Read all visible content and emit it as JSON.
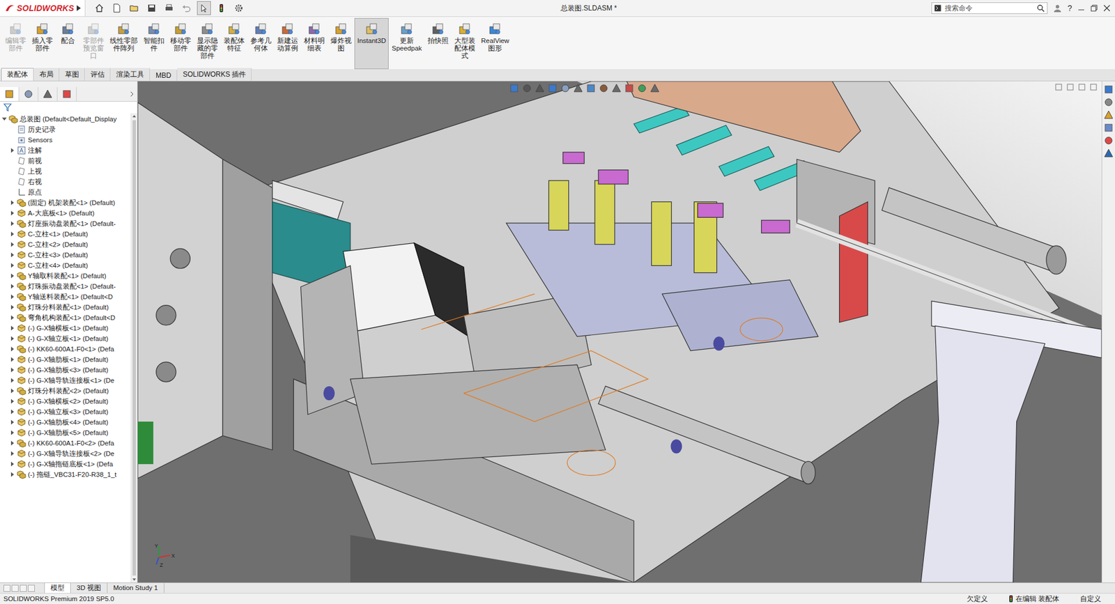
{
  "window": {
    "title": "总装图.SLDASM *"
  },
  "app": {
    "logo": "SOLIDWORKS"
  },
  "search": {
    "placeholder": "搜索命令"
  },
  "help": "?",
  "ribbon": [
    {
      "lines": [
        "编辑零",
        "部件"
      ],
      "disabled": true,
      "selected": false
    },
    {
      "lines": [
        "插入零",
        "部件"
      ],
      "disabled": false,
      "selected": false
    },
    {
      "lines": [
        "配合"
      ],
      "disabled": false,
      "selected": false
    },
    {
      "lines": [
        "零部件",
        "预览窗",
        "口"
      ],
      "disabled": true,
      "selected": false
    },
    {
      "lines": [
        "线性零部",
        "件阵列"
      ],
      "disabled": false,
      "selected": false
    },
    {
      "lines": [
        "智能扣",
        "件"
      ],
      "disabled": false,
      "selected": false
    },
    {
      "lines": [
        "移动零",
        "部件"
      ],
      "disabled": false,
      "selected": false
    },
    {
      "lines": [
        "显示隐",
        "藏的零",
        "部件"
      ],
      "disabled": false,
      "selected": false
    },
    {
      "lines": [
        "装配体",
        "特征"
      ],
      "disabled": false,
      "selected": false
    },
    {
      "lines": [
        "参考几",
        "何体"
      ],
      "disabled": false,
      "selected": false
    },
    {
      "lines": [
        "新建运",
        "动算例"
      ],
      "disabled": false,
      "selected": false
    },
    {
      "lines": [
        "材料明",
        "细表"
      ],
      "disabled": false,
      "selected": false
    },
    {
      "lines": [
        "爆炸视",
        "图"
      ],
      "disabled": false,
      "selected": false
    },
    {
      "lines": [
        "Instant3D"
      ],
      "disabled": false,
      "selected": true
    },
    {
      "lines": [
        "更新",
        "Speedpak"
      ],
      "disabled": false,
      "selected": false
    },
    {
      "lines": [
        "拍快照"
      ],
      "disabled": false,
      "selected": false
    },
    {
      "lines": [
        "大型装",
        "配体模",
        "式"
      ],
      "disabled": false,
      "selected": false
    },
    {
      "lines": [
        "RealView",
        "图形"
      ],
      "disabled": false,
      "selected": false
    }
  ],
  "command_tabs": [
    {
      "label": "装配体",
      "selected": true
    },
    {
      "label": "布局",
      "selected": false
    },
    {
      "label": "草图",
      "selected": false
    },
    {
      "label": "评估",
      "selected": false
    },
    {
      "label": "渲染工具",
      "selected": false
    },
    {
      "label": "MBD",
      "selected": false
    },
    {
      "label": "SOLIDWORKS 插件",
      "selected": false
    }
  ],
  "tree": {
    "root": {
      "label": "总装图  (Default<Default_Display",
      "expanded": true
    },
    "items": [
      {
        "label": "历史记录",
        "kind": "history",
        "expandable": false,
        "expanded": false
      },
      {
        "label": "Sensors",
        "kind": "sensor",
        "expandable": false,
        "expanded": false
      },
      {
        "label": "注解",
        "kind": "annotation",
        "expandable": true,
        "expanded": false
      },
      {
        "label": "前视",
        "kind": "plane",
        "expandable": false,
        "expanded": false
      },
      {
        "label": "上视",
        "kind": "plane",
        "expandable": false,
        "expanded": false
      },
      {
        "label": "右视",
        "kind": "plane",
        "expandable": false,
        "expanded": false
      },
      {
        "label": "原点",
        "kind": "origin",
        "expandable": false,
        "expanded": false
      },
      {
        "label": "(固定) 机架装配<1> (Default)",
        "kind": "assembly",
        "expandable": true,
        "expanded": false
      },
      {
        "label": "A-大底板<1> (Default)",
        "kind": "part",
        "expandable": true,
        "expanded": false
      },
      {
        "label": "灯座振动盘装配<1> (Default-",
        "kind": "assembly",
        "expandable": true,
        "expanded": false
      },
      {
        "label": "C-立柱<1> (Default)",
        "kind": "part",
        "expandable": true,
        "expanded": false
      },
      {
        "label": "C-立柱<2> (Default)",
        "kind": "part",
        "expandable": true,
        "expanded": false
      },
      {
        "label": "C-立柱<3> (Default)",
        "kind": "part",
        "expandable": true,
        "expanded": false
      },
      {
        "label": "C-立柱<4> (Default)",
        "kind": "part",
        "expandable": true,
        "expanded": false
      },
      {
        "label": "Y轴取料装配<1> (Default)",
        "kind": "assembly",
        "expandable": true,
        "expanded": false
      },
      {
        "label": "灯珠振动盘装配<1> (Default-",
        "kind": "assembly",
        "expandable": true,
        "expanded": false
      },
      {
        "label": "Y轴送料装配<1> (Default<D",
        "kind": "assembly",
        "expandable": true,
        "expanded": false
      },
      {
        "label": "灯珠分料装配<1> (Default)",
        "kind": "assembly",
        "expandable": true,
        "expanded": false
      },
      {
        "label": "弯角机构装配<1> (Default<D",
        "kind": "assembly",
        "expandable": true,
        "expanded": false
      },
      {
        "label": "(-) G-X轴横板<1> (Default)",
        "kind": "part",
        "expandable": true,
        "expanded": false
      },
      {
        "label": "(-) G-X轴立板<1> (Default)",
        "kind": "part",
        "expandable": true,
        "expanded": false
      },
      {
        "label": "(-) KK60-600A1-F0<1> (Defa",
        "kind": "assembly",
        "expandable": true,
        "expanded": false
      },
      {
        "label": "(-) G-X轴肋板<1> (Default)",
        "kind": "part",
        "expandable": true,
        "expanded": false
      },
      {
        "label": "(-) G-X轴肋板<3> (Default)",
        "kind": "part",
        "expandable": true,
        "expanded": false
      },
      {
        "label": "(-) G-X轴导轨连接板<1> (De",
        "kind": "part",
        "expandable": true,
        "expanded": false
      },
      {
        "label": "灯珠分料装配<2> (Default)",
        "kind": "assembly",
        "expandable": true,
        "expanded": false
      },
      {
        "label": "(-) G-X轴横板<2> (Default)",
        "kind": "part",
        "expandable": true,
        "expanded": false
      },
      {
        "label": "(-) G-X轴立板<3> (Default)",
        "kind": "part",
        "expandable": true,
        "expanded": false
      },
      {
        "label": "(-) G-X轴肋板<4> (Default)",
        "kind": "part",
        "expandable": true,
        "expanded": false
      },
      {
        "label": "(-) G-X轴肋板<5> (Default)",
        "kind": "part",
        "expandable": true,
        "expanded": false
      },
      {
        "label": "(-) KK60-600A1-F0<2> (Defa",
        "kind": "assembly",
        "expandable": true,
        "expanded": false
      },
      {
        "label": "(-) G-X轴导轨连接板<2> (De",
        "kind": "part",
        "expandable": true,
        "expanded": false
      },
      {
        "label": "(-) G-X轴拖链底板<1> (Defa",
        "kind": "part",
        "expandable": true,
        "expanded": false
      },
      {
        "label": "(-) 拖链_VBC31-F20-R38_1_t",
        "kind": "assembly",
        "expandable": true,
        "expanded": false
      }
    ]
  },
  "panel_tabs": [
    {
      "selected": true
    },
    {
      "selected": false
    },
    {
      "selected": false
    },
    {
      "selected": false
    }
  ],
  "triad": [
    "Y",
    "X",
    "Z"
  ],
  "bottom_tabs": [
    {
      "label": "模型",
      "selected": true
    },
    {
      "label": "3D 视图",
      "selected": false
    },
    {
      "label": "Motion Study 1",
      "selected": false
    }
  ],
  "status_bar": {
    "product": "SOLIDWORKS Premium 2019 SP5.0",
    "items": [
      "欠定义",
      "在编辑 装配体",
      "自定义"
    ]
  }
}
